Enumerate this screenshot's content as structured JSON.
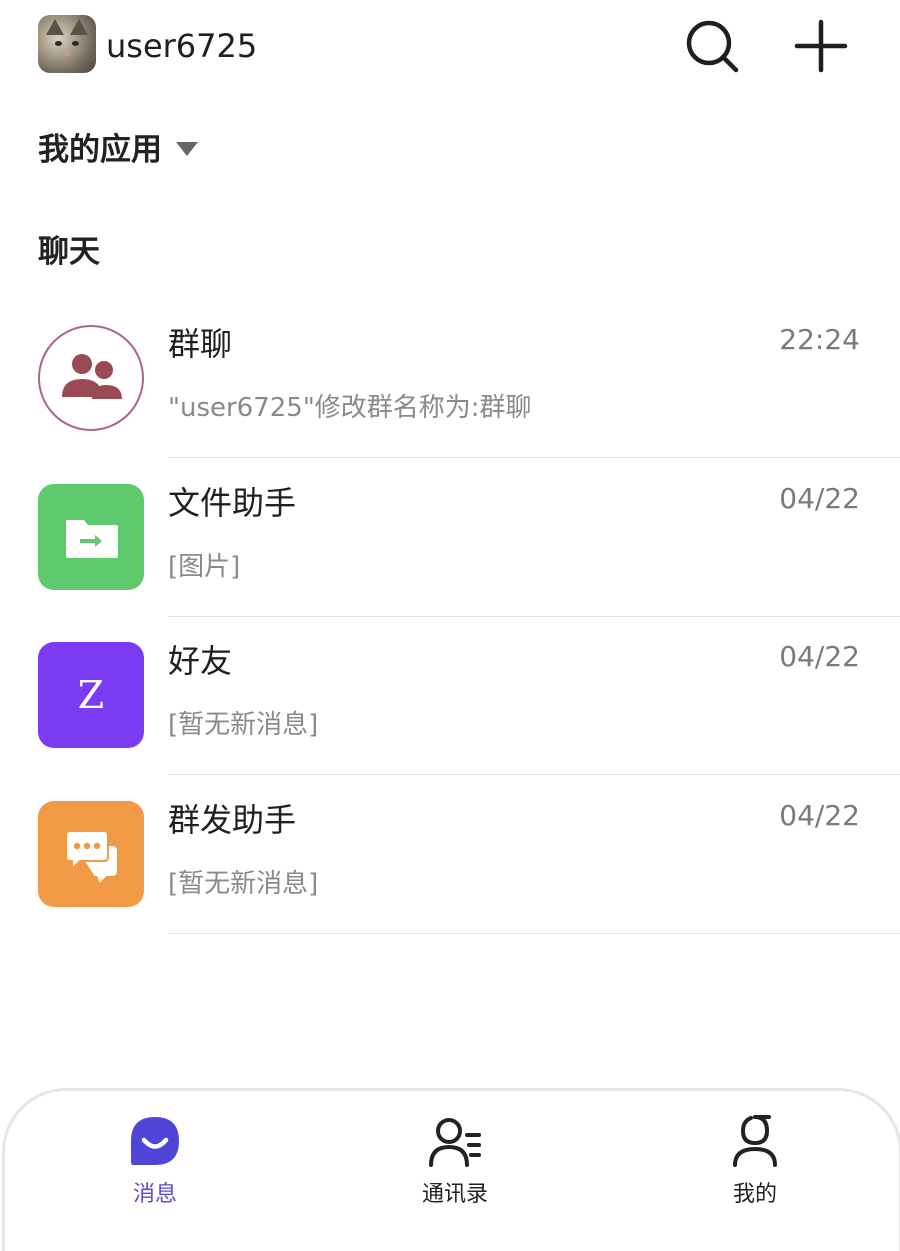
{
  "header": {
    "username": "user6725",
    "avatar_icon": "user-avatar-cat",
    "search_icon": "search-icon",
    "add_icon": "plus-icon"
  },
  "sections": {
    "apps_title": "我的应用",
    "chat_title": "聊天"
  },
  "chats": [
    {
      "name": "群聊",
      "time": "22:24",
      "preview": "\"user6725\"修改群名称为:群聊",
      "icon": "group-chat-icon",
      "color": "#a96a73"
    },
    {
      "name": "文件助手",
      "time": "04/22",
      "preview": "[图片]",
      "icon": "folder-transfer-icon",
      "color": "#5fc96d"
    },
    {
      "name": "好友",
      "time": "04/22",
      "preview": "[暂无新消息]",
      "icon_letter": "Z",
      "color": "#7a3bf2"
    },
    {
      "name": "群发助手",
      "time": "04/22",
      "preview": "[暂无新消息]",
      "icon": "chat-bubbles-icon",
      "color": "#f19945"
    }
  ],
  "tabbar": {
    "tabs": [
      {
        "label": "消息",
        "icon": "message-icon",
        "active": true
      },
      {
        "label": "通讯录",
        "icon": "contacts-icon",
        "active": false
      },
      {
        "label": "我的",
        "icon": "profile-icon",
        "active": false
      }
    ],
    "active_color": "#5a4bd6"
  }
}
